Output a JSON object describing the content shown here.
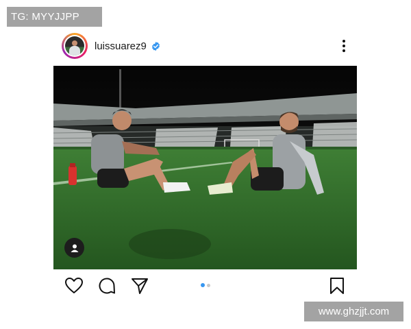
{
  "watermark_top": "TG: MYYJJPP",
  "watermark_bottom": "www.ghzjjt.com",
  "post": {
    "username": "luissuarez9",
    "verified": true,
    "carousel": {
      "total": 2,
      "current": 1
    }
  },
  "icons": {
    "verified": "verified-badge-icon",
    "more": "more-options-icon",
    "user_tag": "person-icon",
    "like": "heart-icon",
    "comment": "comment-icon",
    "share": "send-icon",
    "save": "bookmark-icon"
  },
  "colors": {
    "accent": "#3797f0",
    "verified": "#3797f0",
    "watermark_bg": "#a3a3a3",
    "pitch": "#2f6b2a"
  }
}
